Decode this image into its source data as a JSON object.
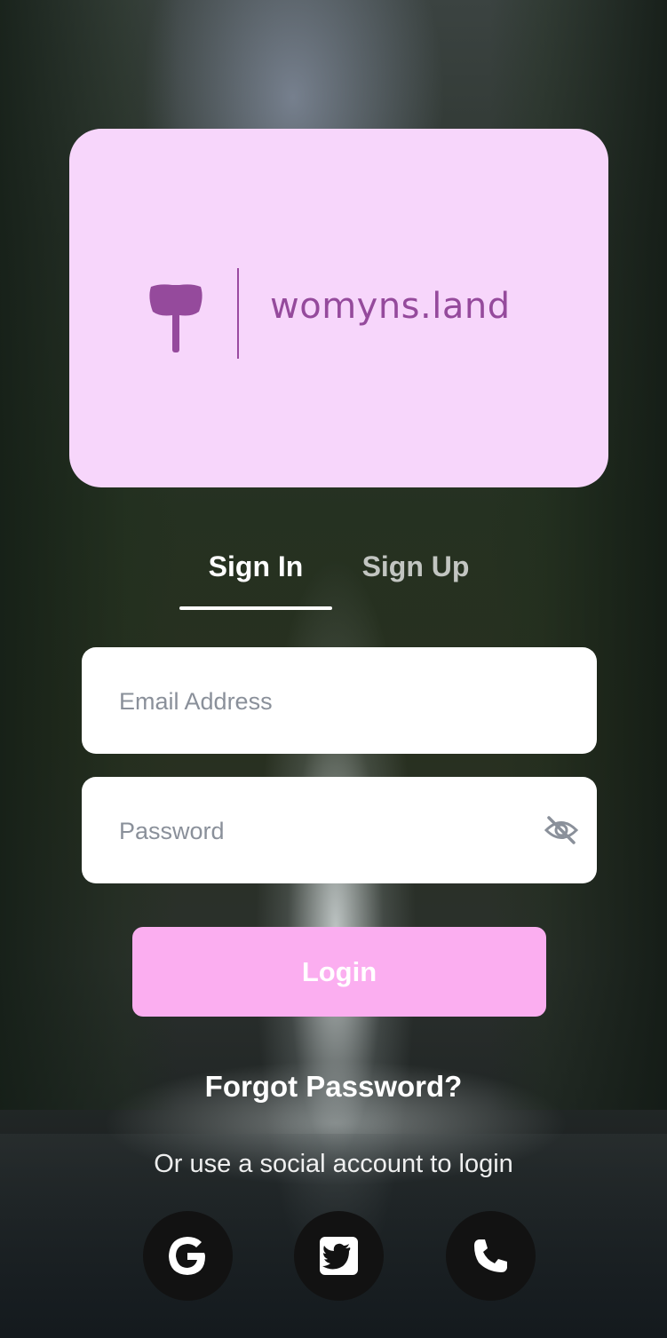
{
  "brand": {
    "name": "womyns.land",
    "logo_icon": "labrys-axe-icon",
    "card_color": "#f7d6fb",
    "accent_color": "#954a9c"
  },
  "tabs": [
    {
      "label": "Sign In",
      "active": true
    },
    {
      "label": "Sign Up",
      "active": false
    }
  ],
  "form": {
    "email_placeholder": "Email Address",
    "email_value": "",
    "password_placeholder": "Password",
    "password_value": "",
    "password_toggle_icon": "eye-slash-icon"
  },
  "login_button": {
    "label": "Login",
    "color": "#fbaef0"
  },
  "forgot_password": "Forgot Password?",
  "social": {
    "caption": "Or use a social account to login",
    "buttons": [
      {
        "icon": "google-icon"
      },
      {
        "icon": "twitter-icon"
      },
      {
        "icon": "phone-icon"
      }
    ]
  }
}
